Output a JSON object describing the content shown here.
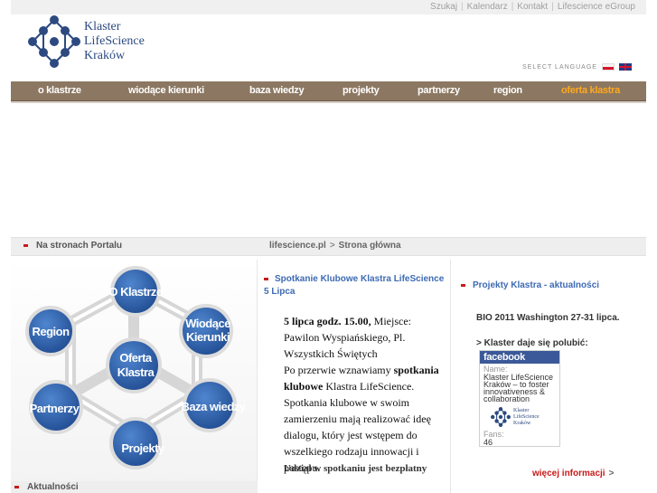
{
  "header": {
    "top_links": [
      "Szukaj",
      "Kalendarz",
      "Kontakt",
      "Lifescience eGroup"
    ],
    "logo_lines": [
      "Klaster",
      "LifeScience",
      "Kraków"
    ],
    "select_language": "SELECT LANGUAGE",
    "logo_color": "#2c4a80"
  },
  "nav": {
    "items": [
      {
        "label": "o klastrze",
        "active": false
      },
      {
        "label": "wiodące kierunki",
        "active": false
      },
      {
        "label": "baza wiedzy",
        "active": false
      },
      {
        "label": "projekty",
        "active": false
      },
      {
        "label": "partnerzy",
        "active": false
      },
      {
        "label": "region",
        "active": false
      },
      {
        "label": "oferta klastra",
        "active": true
      }
    ],
    "background": "#8c7862",
    "active_color": "#ffa821"
  },
  "breadcrumb": {
    "portal_label": "Na stronach Portalu",
    "items": [
      "lifescience.pl",
      "Strona główna"
    ]
  },
  "diagram": {
    "nodes": {
      "o_klastrze": [
        "O Klastrze"
      ],
      "wiodace": [
        "Wiodące",
        "Kierunki"
      ],
      "region": [
        "Region"
      ],
      "oferta": [
        "Oferta",
        "Klastra"
      ],
      "partnerzy": [
        "Partnerzy"
      ],
      "baza": [
        "Baza wiedzy"
      ],
      "projekty": [
        "Projekty"
      ]
    },
    "node_color": "#2c5aa0"
  },
  "news_label": "Aktualności",
  "middle": {
    "title_line1": "Spotkanie Klubowe Klastra LifeScience",
    "title_line2": "5 Lipca",
    "p1_bold": "5 lipca godz. 15.00,",
    "p1_rest": " Miejsce: Pawilon Wyspiańskiego, Pl. Wszystkich Świętych",
    "p2_start": "Po przerwie wznawiamy ",
    "p2_bold": "spotkania klubowe",
    "p2_end": " Klastra LifeScience.",
    "p3": "Spotkania klubowe w swoim zamierzeniu mają realizować ideę dialogu, który jest wstępem do wszelkiego rodzaju innowacji i postępu.",
    "footer": "Udział w spotkaniu jest bezpłatny"
  },
  "right": {
    "title": "Projekty Klastra - aktualności",
    "news_item": "BIO 2011 Washington 27-31 lipca.",
    "fb_link": "> Klaster daje się polubić:",
    "facebook": {
      "brand": "facebook",
      "name_key": "Name:",
      "name_value": "Klaster LifeScience Kraków – to foster innovativeness & collaboration",
      "logo_lines": [
        "Klaster",
        "LifeScience",
        "Kraków"
      ],
      "fans_key": "Fans:",
      "fans_value": "46",
      "brand_color": "#3b5998"
    },
    "more": "więcej informacji"
  }
}
